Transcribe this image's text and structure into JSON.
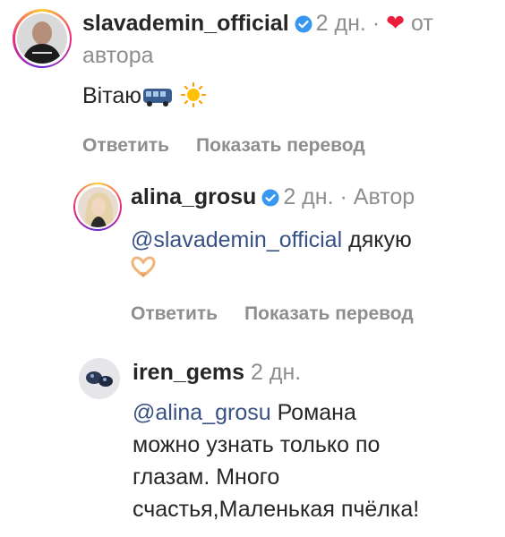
{
  "comments": [
    {
      "username": "slavademin_official",
      "verified": true,
      "time": "2 дн.",
      "dot": "·",
      "heart_icon": "heart-icon",
      "by_author": "от автора",
      "text": "Вітаю",
      "emoji": [
        "bus-icon",
        "sun-icon"
      ],
      "reply_label": "Ответить",
      "translate_label": "Показать перевод"
    },
    {
      "username": "alina_grosu",
      "verified": true,
      "time": "2 дн.",
      "dot": "·",
      "author_label": "Автор",
      "mention": "@slavademin_official",
      "text": "дякую",
      "emoji": [
        "heart-hands-icon"
      ],
      "reply_label": "Ответить",
      "translate_label": "Показать перевод"
    },
    {
      "username": "iren_gems",
      "verified": false,
      "time": "2 дн.",
      "mention": "@alina_grosu",
      "text_line1": "Романа",
      "text_line2": "можно узнать только по",
      "text_line3": "глазам. Много",
      "text_line4": "счастья,Маленькая пчёлка!"
    }
  ],
  "colors": {
    "text": "#262626",
    "meta": "#8e8e8e",
    "mention": "#385185",
    "verified": "#3897f0",
    "heart": "#ed1d3c"
  }
}
